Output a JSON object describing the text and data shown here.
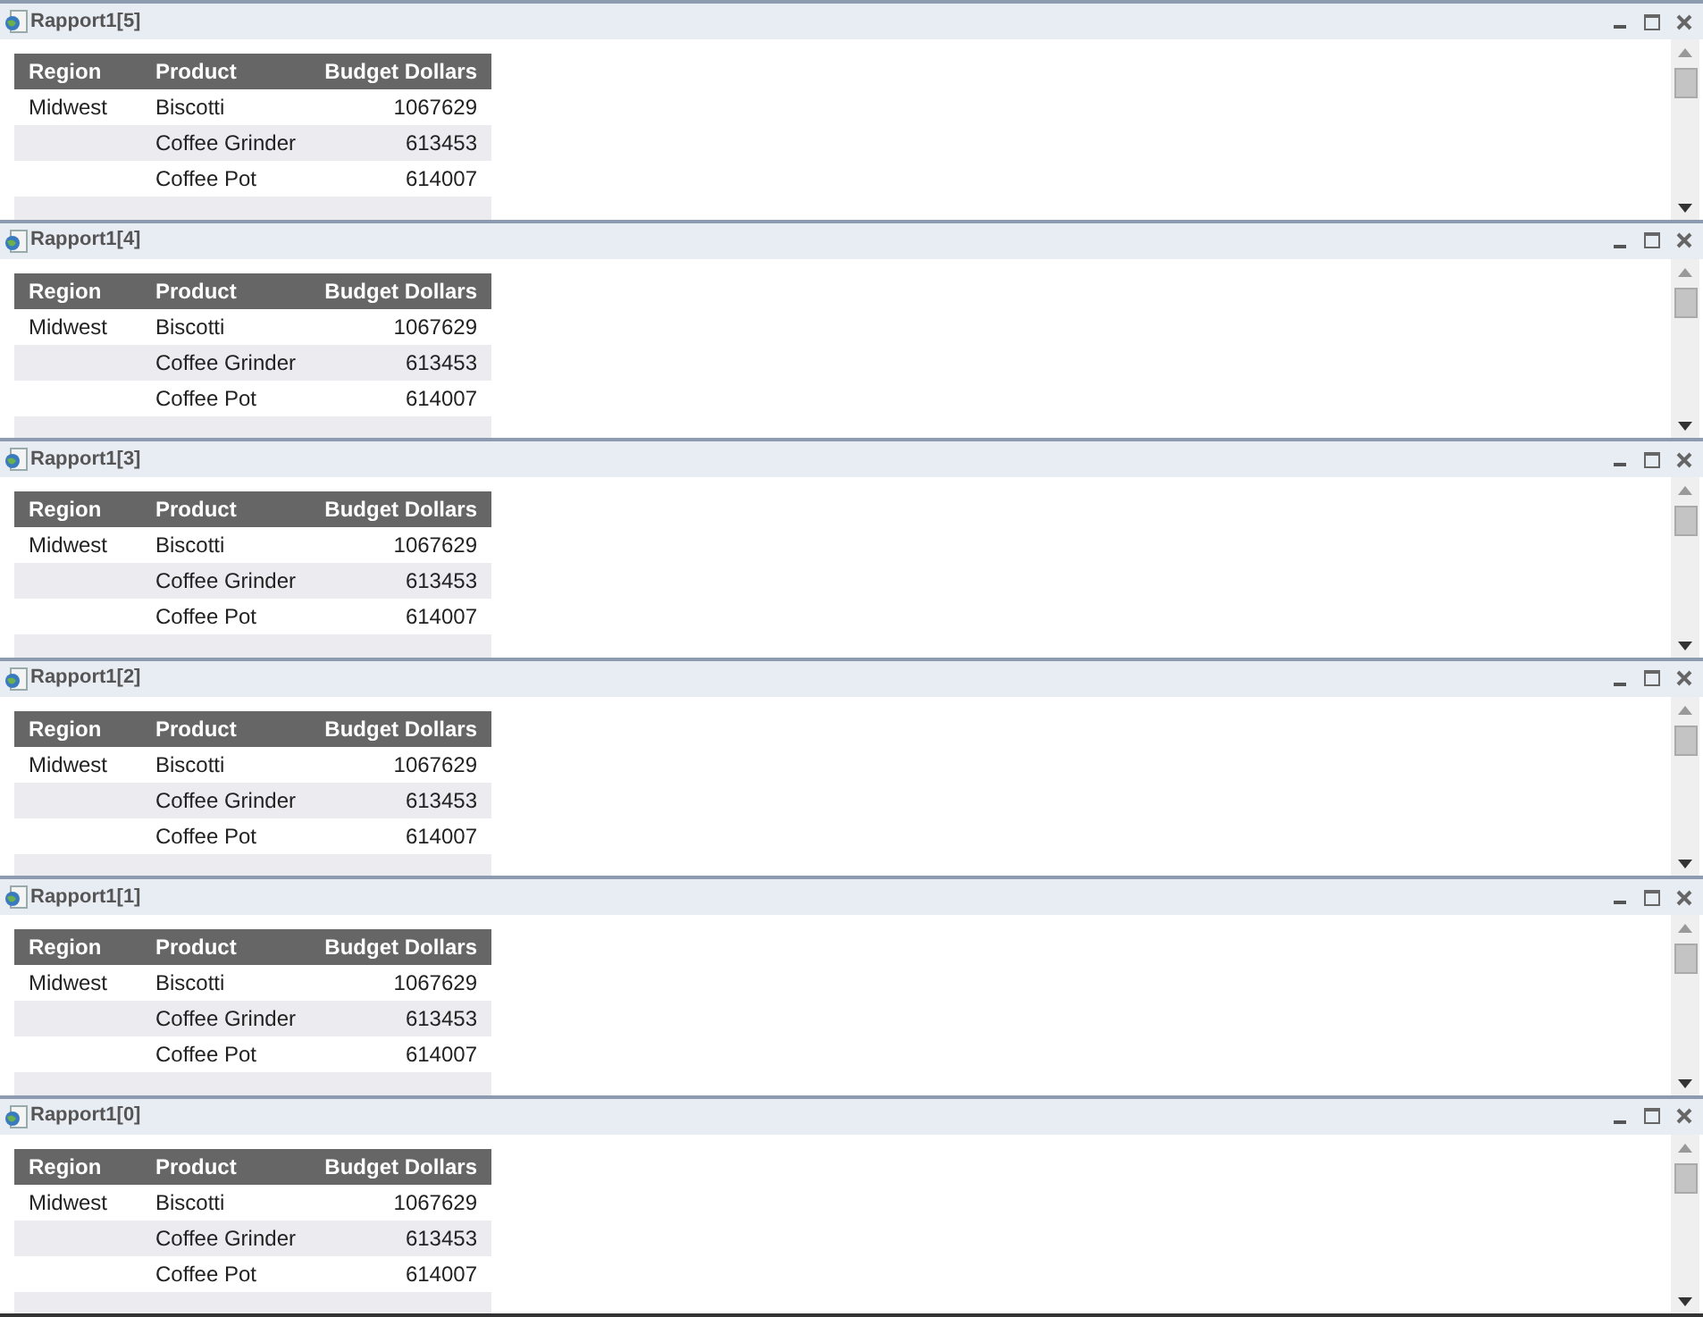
{
  "windows": [
    {
      "title": "Rapport1[5]",
      "columns": [
        "Region",
        "Product",
        "Budget Dollars"
      ],
      "rows": [
        [
          "Midwest",
          "Biscotti",
          "1067629"
        ],
        [
          "",
          "Coffee Grinder",
          "613453"
        ],
        [
          "",
          "Coffee Pot",
          "614007"
        ]
      ]
    },
    {
      "title": "Rapport1[4]",
      "columns": [
        "Region",
        "Product",
        "Budget Dollars"
      ],
      "rows": [
        [
          "Midwest",
          "Biscotti",
          "1067629"
        ],
        [
          "",
          "Coffee Grinder",
          "613453"
        ],
        [
          "",
          "Coffee Pot",
          "614007"
        ]
      ]
    },
    {
      "title": "Rapport1[3]",
      "columns": [
        "Region",
        "Product",
        "Budget Dollars"
      ],
      "rows": [
        [
          "Midwest",
          "Biscotti",
          "1067629"
        ],
        [
          "",
          "Coffee Grinder",
          "613453"
        ],
        [
          "",
          "Coffee Pot",
          "614007"
        ]
      ]
    },
    {
      "title": "Rapport1[2]",
      "columns": [
        "Region",
        "Product",
        "Budget Dollars"
      ],
      "rows": [
        [
          "Midwest",
          "Biscotti",
          "1067629"
        ],
        [
          "",
          "Coffee Grinder",
          "613453"
        ],
        [
          "",
          "Coffee Pot",
          "614007"
        ]
      ]
    },
    {
      "title": "Rapport1[1]",
      "columns": [
        "Region",
        "Product",
        "Budget Dollars"
      ],
      "rows": [
        [
          "Midwest",
          "Biscotti",
          "1067629"
        ],
        [
          "",
          "Coffee Grinder",
          "613453"
        ],
        [
          "",
          "Coffee Pot",
          "614007"
        ]
      ]
    },
    {
      "title": "Rapport1[0]",
      "columns": [
        "Region",
        "Product",
        "Budget Dollars"
      ],
      "rows": [
        [
          "Midwest",
          "Biscotti",
          "1067629"
        ],
        [
          "",
          "Coffee Grinder",
          "613453"
        ],
        [
          "",
          "Coffee Pot",
          "614007"
        ]
      ]
    }
  ]
}
